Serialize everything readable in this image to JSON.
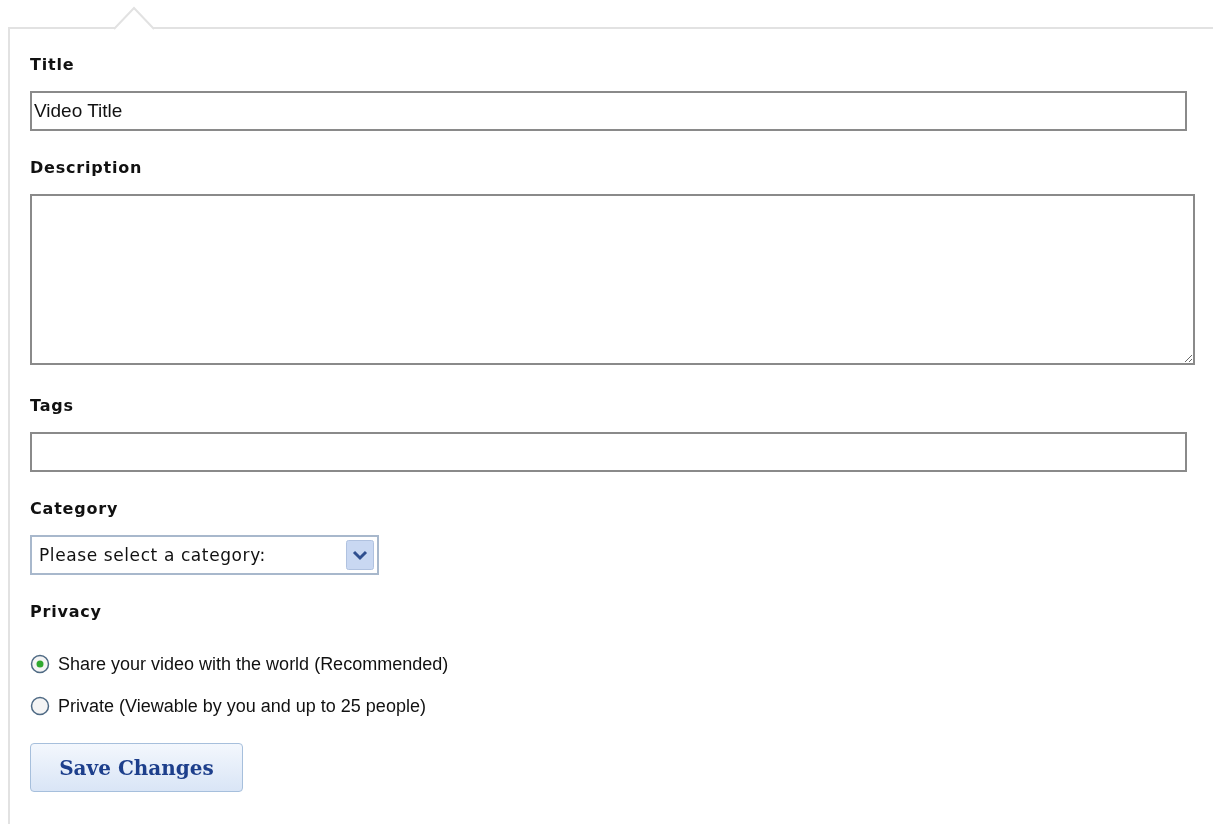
{
  "fields": [
    {
      "kind": "input",
      "label": "Title",
      "value": "Video Title"
    },
    {
      "kind": "textarea",
      "label": "Description"
    },
    {
      "kind": "input",
      "label": "Tags"
    },
    {
      "kind": "select",
      "label": "Category",
      "value": "Please select a category:"
    }
  ],
  "privacy": {
    "label": "Privacy",
    "options": [
      {
        "label": "Share your video with the world (Recommended)",
        "selected": true
      },
      {
        "label": "Private (Viewable by you and up to 25 people)",
        "selected": false
      }
    ]
  },
  "save_button": "Save Changes"
}
